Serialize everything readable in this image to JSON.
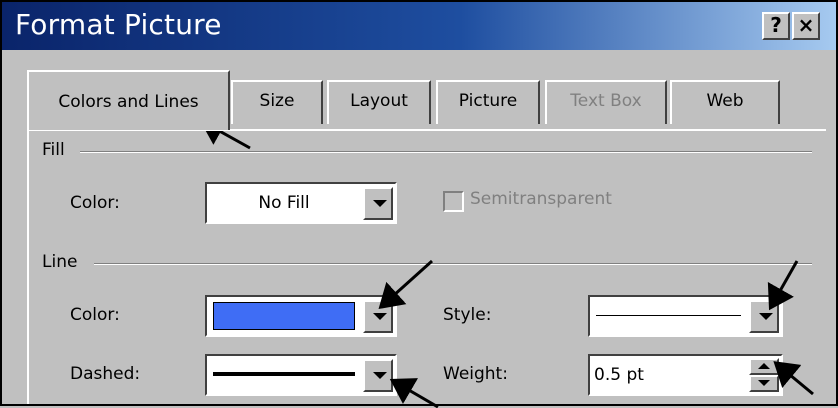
{
  "window": {
    "title": "Format Picture",
    "help_label": "?",
    "close_label": "×"
  },
  "tabs": [
    {
      "label": "Colors and Lines",
      "active": true
    },
    {
      "label": "Size"
    },
    {
      "label": "Layout"
    },
    {
      "label": "Picture"
    },
    {
      "label": "Text Box",
      "disabled": true
    },
    {
      "label": "Web"
    }
  ],
  "fill": {
    "group_label": "Fill",
    "color_label": "Color:",
    "color_value": "No Fill",
    "semitransparent_label": "Semitransparent",
    "semitransparent_checked": false
  },
  "line": {
    "group_label": "Line",
    "color_label": "Color:",
    "color_hex": "#3f6df5",
    "dashed_label": "Dashed:",
    "style_label": "Style:",
    "weight_label": "Weight:",
    "weight_value": "0.5 pt"
  },
  "annotations": {
    "arrow_color": "#000000"
  }
}
